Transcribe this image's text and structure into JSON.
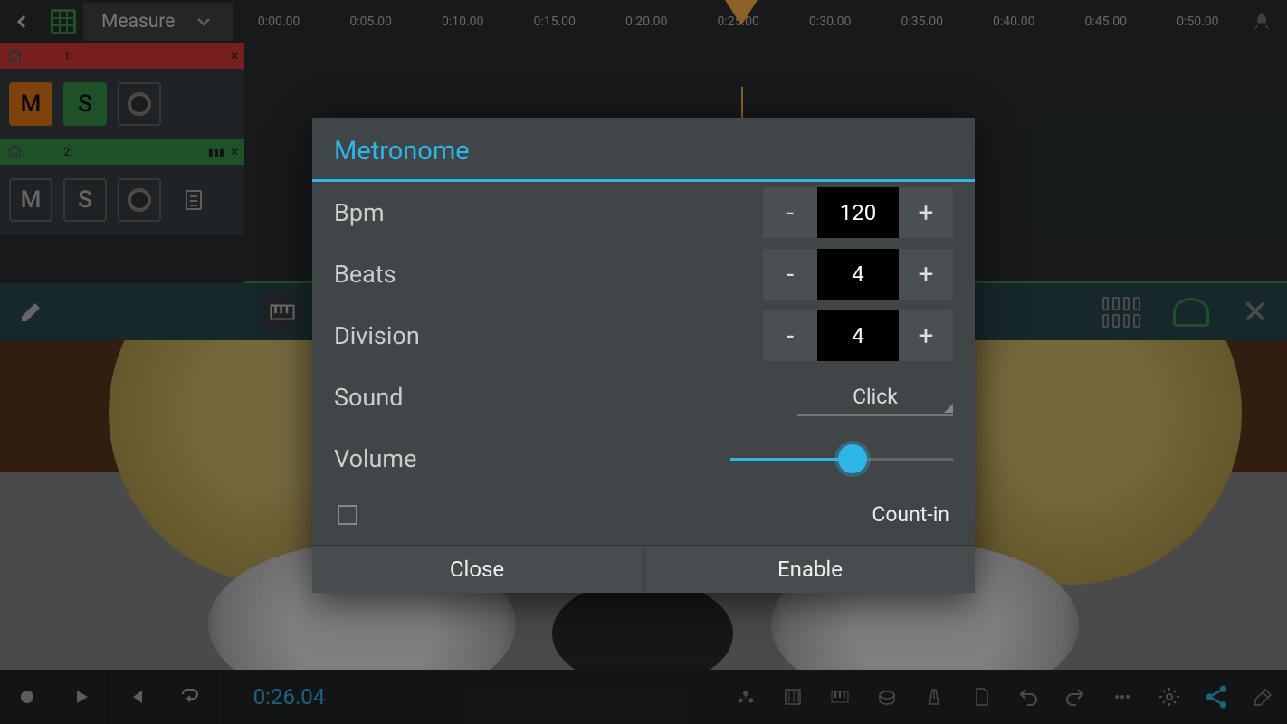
{
  "toolbar": {
    "mode": "Measure"
  },
  "ruler": [
    "0:00.00",
    "0:05.00",
    "0:10.00",
    "0:15.00",
    "0:20.00",
    "0:25.00",
    "0:30.00",
    "0:35.00",
    "0:40.00",
    "0:45.00",
    "0:50.00"
  ],
  "tracks": [
    {
      "num": "1:",
      "mute": "M",
      "solo": "S"
    },
    {
      "num": "2:",
      "mute": "M",
      "solo": "S"
    }
  ],
  "transport": {
    "time": "0:26.04"
  },
  "modal": {
    "title": "Metronome",
    "bpm_label": "Bpm",
    "bpm": "120",
    "beats_label": "Beats",
    "beats": "4",
    "division_label": "Division",
    "division": "4",
    "sound_label": "Sound",
    "sound_value": "Click",
    "volume_label": "Volume",
    "volume_pct": 55,
    "countin_label": "Count-in",
    "countin_checked": false,
    "close": "Close",
    "enable": "Enable",
    "minus": "-",
    "plus": "+"
  }
}
